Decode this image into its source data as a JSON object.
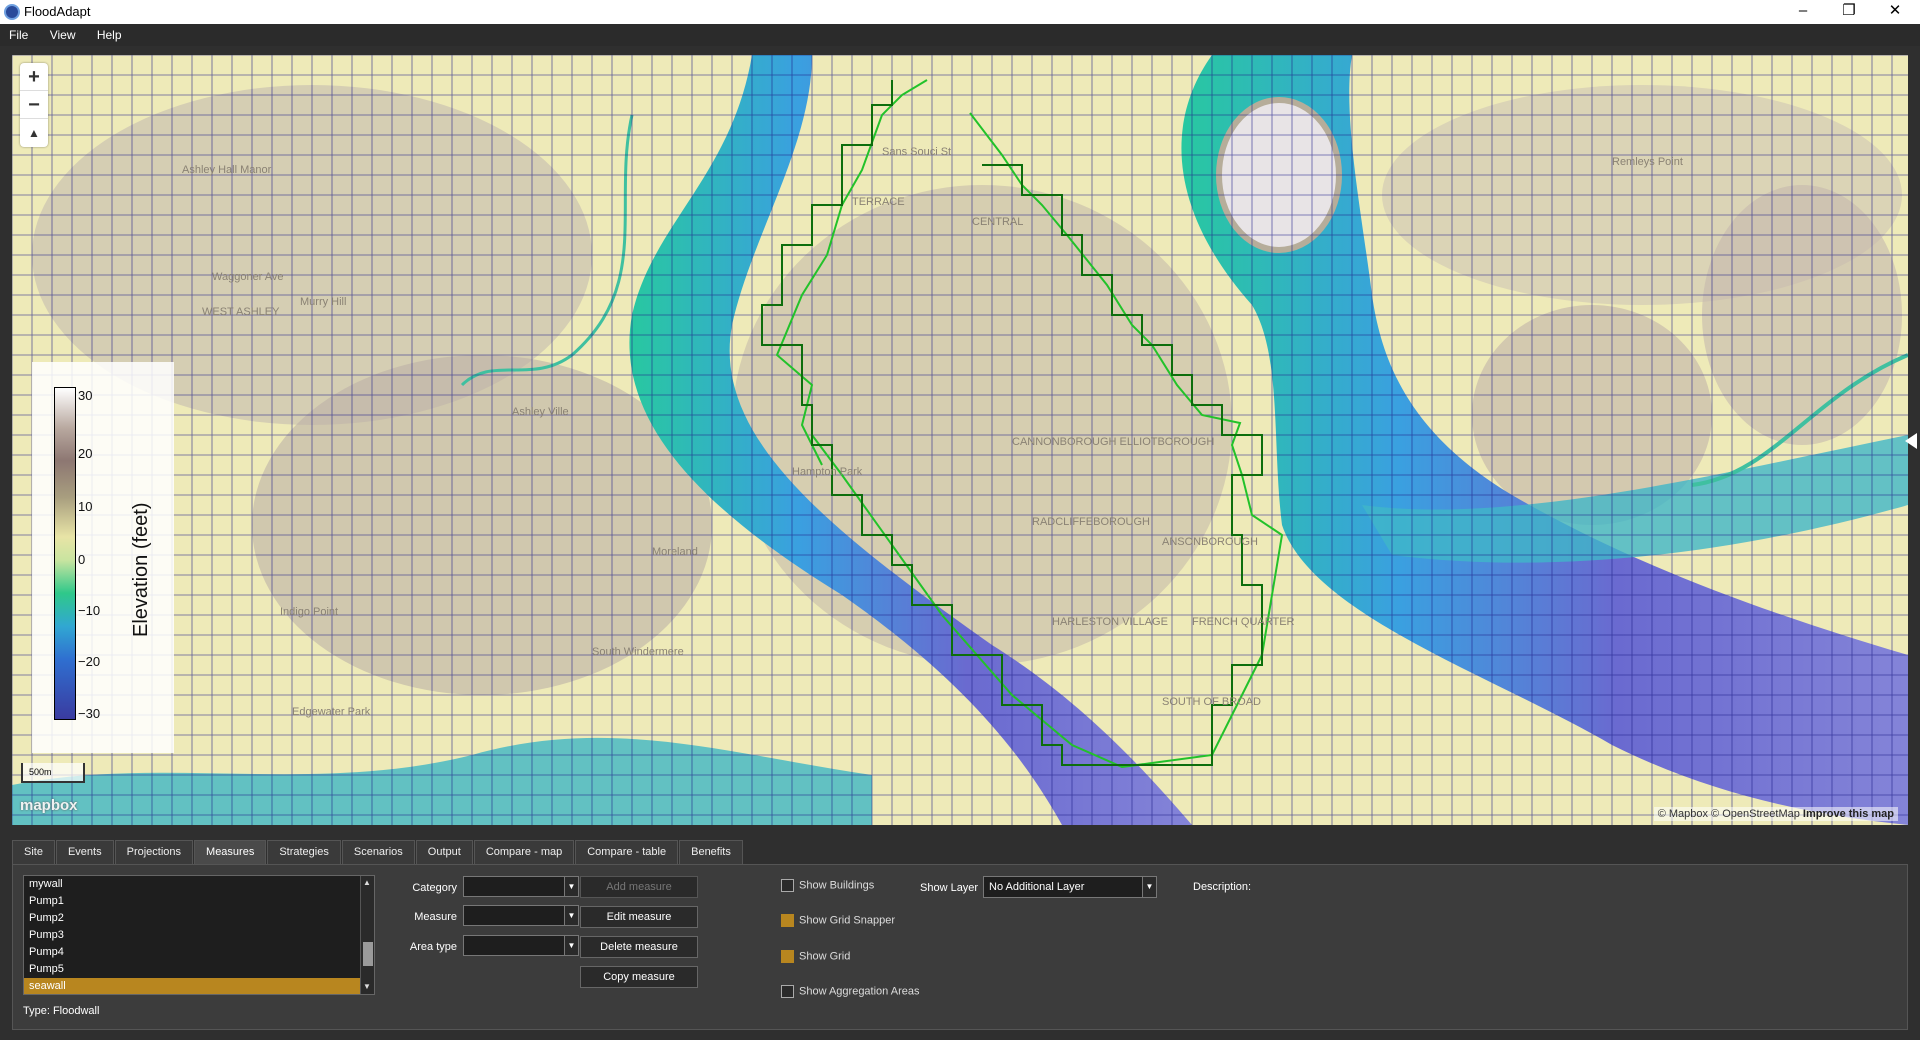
{
  "window": {
    "title": "FloodAdapt",
    "minimize": "–",
    "restore": "❐",
    "close": "✕"
  },
  "menu": [
    "File",
    "View",
    "Help"
  ],
  "map": {
    "zoom_in": "+",
    "zoom_out": "−",
    "compass": "▲",
    "legend": {
      "label": "Elevation (feet)",
      "ticks": [
        "30",
        "20",
        "10",
        "0",
        "−10",
        "−20",
        "−30"
      ]
    },
    "scale": "500m",
    "logo": "mapbox",
    "attribution": "© Mapbox © OpenStreetMap",
    "improve": "Improve this map",
    "place_labels": [
      "Ashley Hall Manor",
      "Murry Hill",
      "WEST ASHLEY",
      "Ashley Ville",
      "Moreland",
      "Indigo Point",
      "South Windermere",
      "Edgewater Park",
      "TERRACE",
      "CENTRAL",
      "CANNONBOROUGH ELLIOTBOROUGH",
      "RADCLIFFEBOROUGH",
      "ANSONBOROUGH",
      "HARLESTON VILLAGE",
      "FRENCH QUARTER",
      "SOUTH OF BROAD",
      "Remleys Point",
      "Hampton Park",
      "Waggoner Ave",
      "Sans Souci St"
    ]
  },
  "tabs": [
    "Site",
    "Events",
    "Projections",
    "Measures",
    "Strategies",
    "Scenarios",
    "Output",
    "Compare - map",
    "Compare - table",
    "Benefits"
  ],
  "active_tab": "Measures",
  "measures": {
    "items": [
      "mywall",
      "Pump1",
      "Pump2",
      "Pump3",
      "Pump4",
      "Pump5",
      "seawall"
    ],
    "selected": "seawall",
    "type_line": "Type: Floodwall",
    "category_label": "Category",
    "measure_label": "Measure",
    "area_type_label": "Area type",
    "category_value": "",
    "measure_value": "",
    "area_type_value": "",
    "buttons": {
      "add": "Add measure",
      "edit": "Edit measure",
      "delete": "Delete measure",
      "copy": "Copy measure"
    },
    "checks": {
      "buildings": {
        "label": "Show Buildings",
        "checked": false
      },
      "grid_snapper": {
        "label": "Show Grid Snapper",
        "checked": true
      },
      "grid": {
        "label": "Show Grid",
        "checked": true
      },
      "aggregation": {
        "label": "Show Aggregation Areas",
        "checked": false
      }
    },
    "show_layer_label": "Show Layer",
    "show_layer_value": "No Additional Layer",
    "description_label": "Description:"
  },
  "colors": {
    "accent": "#b8861f",
    "grid_lines": "#1f1f8a",
    "wall_line": "#22c22a",
    "snapped_line": "#0d6e0d"
  }
}
